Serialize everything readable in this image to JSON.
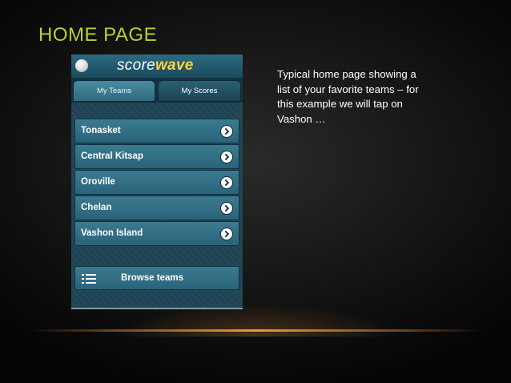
{
  "slide": {
    "title": "HOME PAGE",
    "note": "Typical home page showing a list of your favorite teams – for this example we will tap on Vashon …"
  },
  "app": {
    "brand_part1": "score",
    "brand_part2": "wave",
    "tabs": [
      {
        "label": "My Teams",
        "active": true
      },
      {
        "label": "My Scores",
        "active": false
      }
    ],
    "teams": [
      {
        "label": "Tonasket"
      },
      {
        "label": "Central Kitsap"
      },
      {
        "label": "Oroville"
      },
      {
        "label": "Chelan"
      },
      {
        "label": "Vashon Island"
      }
    ],
    "browse_label": "Browse teams",
    "colors": {
      "title_accent": "#b9cf35",
      "app_bg": "#1e4250",
      "row_bg": "#2f6b80",
      "brand_highlight": "#ffd23a"
    },
    "icons": {
      "logo": "scorewave-ball-icon",
      "row_action": "chevron-right-icon",
      "browse": "list-icon"
    }
  }
}
